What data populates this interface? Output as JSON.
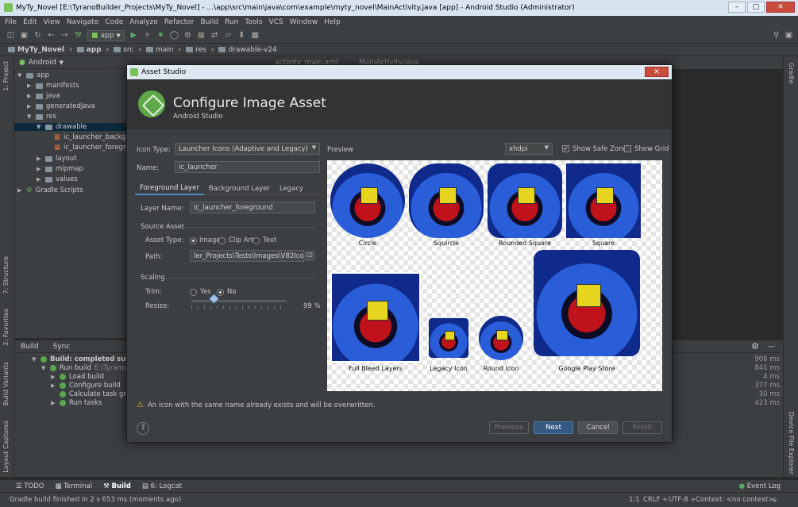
{
  "window": {
    "title": "MyTy_Novel [E:\\TyranoBuilder_Projects\\MyTy_Novel] - ...\\app\\src\\main\\java\\com\\example\\myty_novel\\MainActivity.java [app] - Android Studio (Administrator)",
    "min": "–",
    "max": "□",
    "close": "✕"
  },
  "menu": [
    "File",
    "Edit",
    "View",
    "Navigate",
    "Code",
    "Analyze",
    "Refactor",
    "Build",
    "Run",
    "Tools",
    "VCS",
    "Window",
    "Help"
  ],
  "toolbar": {
    "run_config": "app"
  },
  "breadcrumb": [
    "MyTy_Novel",
    "app",
    "src",
    "main",
    "res",
    "drawable-v24"
  ],
  "left_tool_tabs": [
    "1: Project",
    "7: Structure",
    "2: Favorites",
    "Build Variants",
    "Layout Captures"
  ],
  "right_tool_tabs": [
    "Gradle",
    "Device File Explorer"
  ],
  "project": {
    "view_mode": "Android",
    "tree": [
      {
        "label": "app"
      },
      {
        "label": "manifests"
      },
      {
        "label": "java"
      },
      {
        "label": "generatedJava"
      },
      {
        "label": "res"
      },
      {
        "label": "drawable"
      },
      {
        "label": "ic_launcher_backgrou"
      },
      {
        "label": "ic_launcher_foregrour"
      },
      {
        "label": "layout"
      },
      {
        "label": "mipmap"
      },
      {
        "label": "values"
      },
      {
        "label": "Gradle Scripts"
      }
    ]
  },
  "editor_tabs": [
    "activity_main.xml",
    "MainActivity.java"
  ],
  "build_panel": {
    "tabs": [
      "Build",
      "Sync"
    ],
    "items": [
      {
        "label": "Build: completed successf",
        "time": "906 ms"
      },
      {
        "label": "Run build",
        "path": "E:\\TyranoBu",
        "time": "841 ms"
      },
      {
        "label": "Load build",
        "time": "4 ms"
      },
      {
        "label": "Configure build",
        "time": "377 ms"
      },
      {
        "label": "Calculate task grapl",
        "time": "30 ms"
      },
      {
        "label": "Run tasks",
        "time": "423 ms"
      }
    ]
  },
  "bottom_tabs": [
    "TODO",
    "Terminal",
    "Build",
    "6: Logcat"
  ],
  "event_log": "Event Log",
  "status": {
    "message": "Gradle build finished in 2 s 653 ms (moments ago)",
    "position": "1:1",
    "line_sep": "CRLF ÷",
    "encoding": "UTF-8 ÷",
    "context": "Context: <no context>"
  },
  "dialog": {
    "window_title": "Asset Studio",
    "heading": "Configure Image Asset",
    "subheading": "Android Studio",
    "icon_type_label": "Icon Type:",
    "icon_type_value": "Launcher Icons (Adaptive and Legacy)",
    "name_label": "Name:",
    "name_value": "ic_launcher",
    "tabs": [
      "Foreground Layer",
      "Background Layer",
      "Legacy"
    ],
    "layer_name_label": "Layer Name:",
    "layer_name_value": "ic_launcher_foreground",
    "source_asset_label": "Source Asset",
    "asset_type_label": "Asset Type:",
    "asset_types": [
      "Image",
      "Clip Art",
      "Text"
    ],
    "asset_type_selected": "Image",
    "path_label": "Path:",
    "path_value": "ler_Projects\\Tests\\Images\\V82Icon.png",
    "scaling_label": "Scaling",
    "trim_label": "Trim:",
    "trim_options": [
      "Yes",
      "No"
    ],
    "trim_selected": "No",
    "resize_label": "Resize:",
    "resize_value": "99 %",
    "preview_label": "Preview",
    "density_value": "xhdpi",
    "show_safe_zone_label": "Show Safe Zone",
    "show_safe_zone_checked": true,
    "show_grid_label": "Show Grid",
    "show_grid_checked": false,
    "preview_items": [
      "Circle",
      "Squircle",
      "Rounded Square",
      "Square",
      "Full Bleed Layers",
      "Legacy Icon",
      "Round Icon",
      "Google Play Store"
    ],
    "warning": "An icon with the same name already exists and will be overwritten.",
    "help": "?",
    "buttons": {
      "previous": "Previous",
      "next": "Next",
      "cancel": "Cancel",
      "finish": "Finish"
    }
  }
}
